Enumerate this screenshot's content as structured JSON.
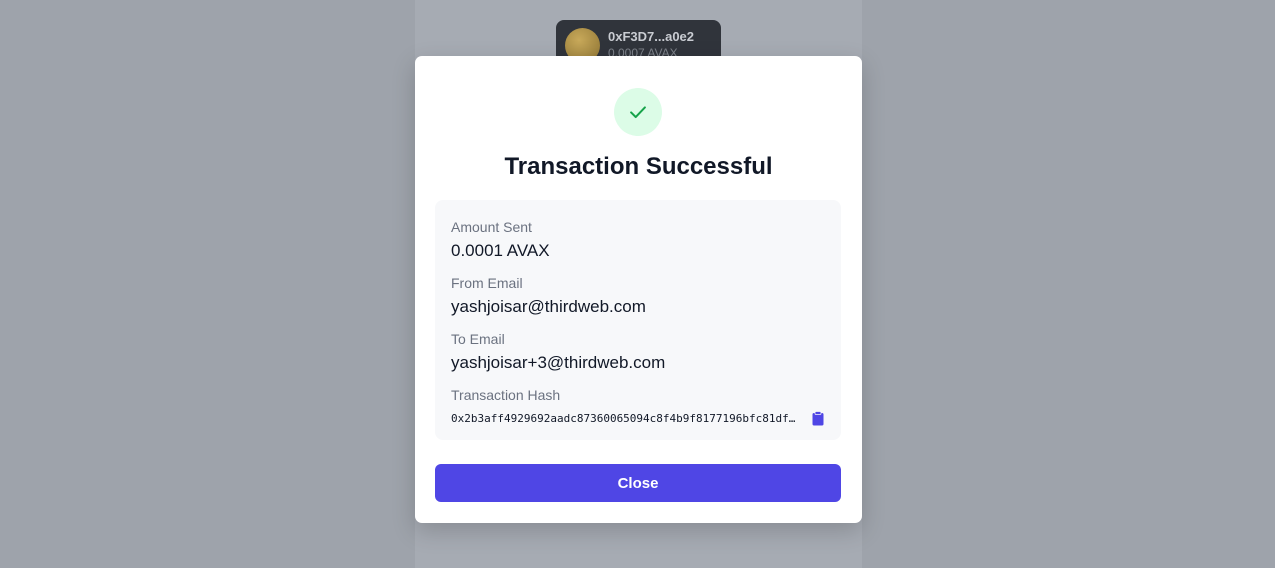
{
  "wallet": {
    "address": "0xF3D7...a0e2",
    "balance": "0.0007 AVAX"
  },
  "modal": {
    "title": "Transaction Successful",
    "details": {
      "amount": {
        "label": "Amount Sent",
        "value": "0.0001 AVAX"
      },
      "from": {
        "label": "From Email",
        "value": "yashjoisar@thirdweb.com"
      },
      "to": {
        "label": "To Email",
        "value": "yashjoisar+3@thirdweb.com"
      },
      "hash": {
        "label": "Transaction Hash",
        "value": "0x2b3aff4929692aadc87360065094c8f4b9f8177196bfc81df9…"
      }
    },
    "close_label": "Close"
  },
  "colors": {
    "overlay": "#9ea3ab",
    "accent": "#4f46e5",
    "success": "#16a34a",
    "success_bg": "#dcfce7"
  },
  "icons": {
    "success": "check-icon",
    "copy": "clipboard-icon"
  }
}
